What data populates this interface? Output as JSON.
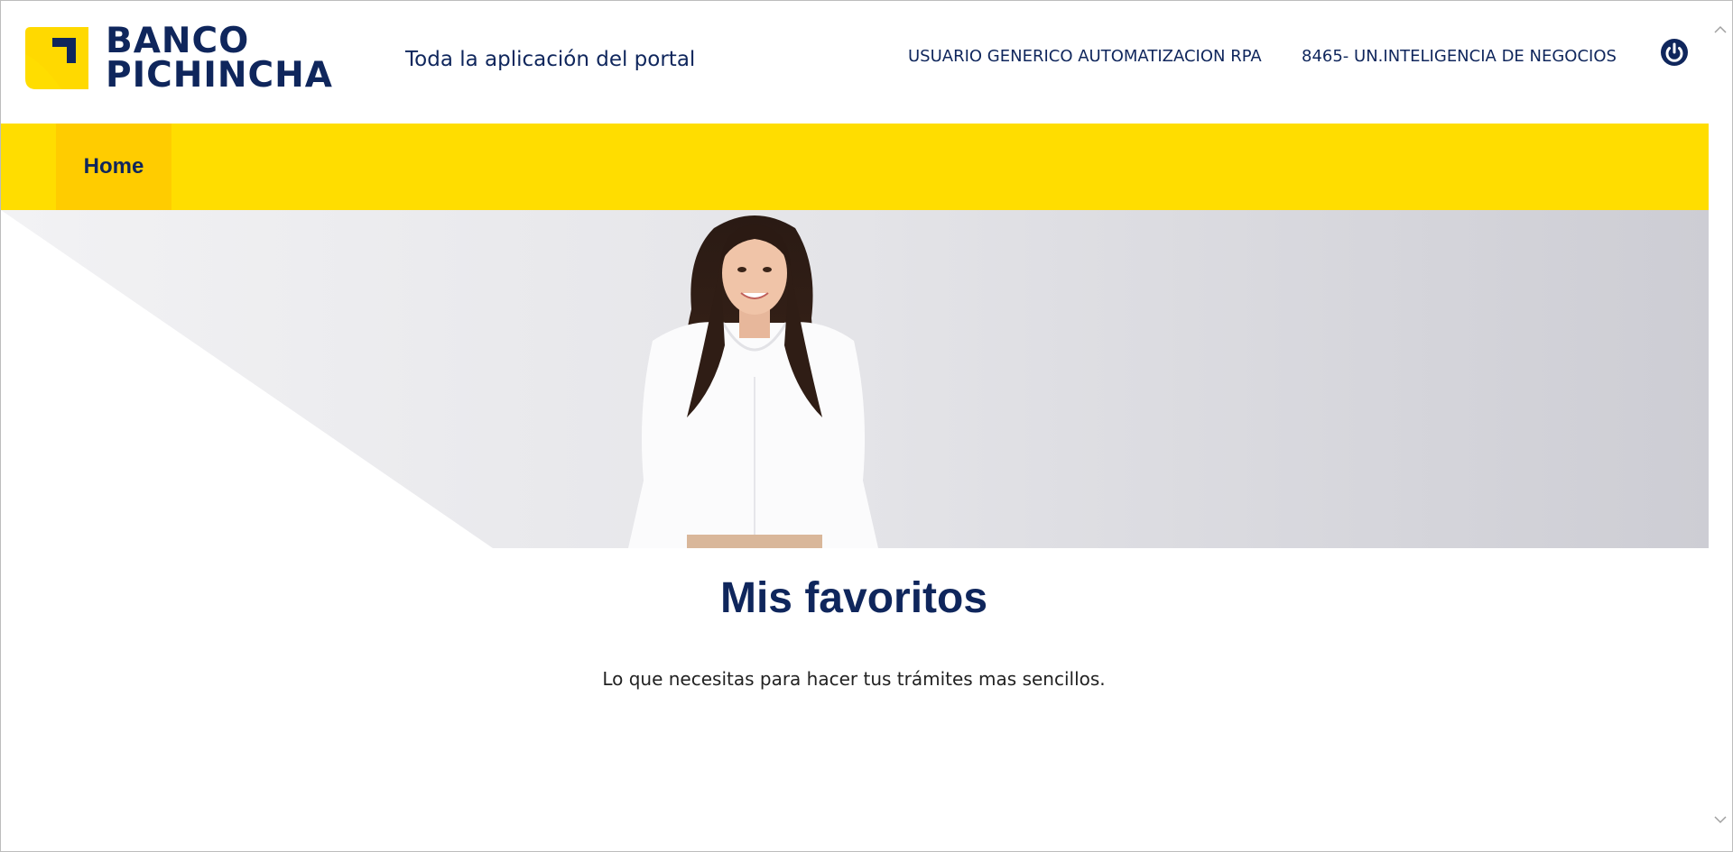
{
  "brand": {
    "line1": "BANCO",
    "line2": "PICHINCHA",
    "primary_color": "#0f265c",
    "accent_color": "#ffdd00"
  },
  "header": {
    "portal_title": "Toda la aplicación del portal",
    "user_name": "USUARIO GENERICO AUTOMATIZACION RPA",
    "unit_name": "8465- UN.INTELIGENCIA DE NEGOCIOS",
    "logout_icon": "power-icon"
  },
  "nav": {
    "items": [
      {
        "label": "Home",
        "active": true
      }
    ]
  },
  "banner": {
    "image": "woman-in-white-blouse-photo"
  },
  "main": {
    "title": "Mis favoritos",
    "subtitle": "Lo que necesitas para hacer tus trámites mas sencillos."
  }
}
